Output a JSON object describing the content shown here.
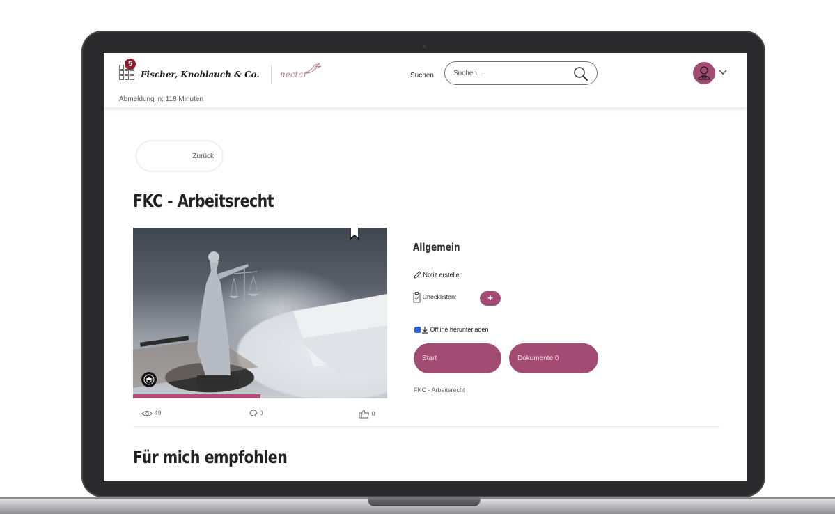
{
  "header": {
    "apps_badge": "5",
    "brand_name": "Fischer, Knoblauch & Co.",
    "product_name": "nectar",
    "session_timeout": "Abmeldung in: 118 Minuten",
    "search_label": "Suchen",
    "search_placeholder": "Suchen..."
  },
  "nav": {
    "back_label": "Zurück"
  },
  "course": {
    "title": "FKC - Arbeitsrecht",
    "views": "49",
    "comments": "0",
    "likes": "0",
    "progress_fraction": 0.5
  },
  "details": {
    "section_title": "Allgemein",
    "note_label": "Notiz erstellen",
    "checklist_label": "Checklisten:",
    "checklist_add": "+",
    "offline_label": "Offline herunterladen",
    "offline_checked": true,
    "start_label": "Start",
    "documents_label": "Dokumente 0",
    "course_name": "FKC - Arbeitsrecht"
  },
  "recommendations": {
    "title": "Für mich empfohlen"
  },
  "colors": {
    "accent": "#a24c73",
    "badge": "#8e1d2f"
  }
}
